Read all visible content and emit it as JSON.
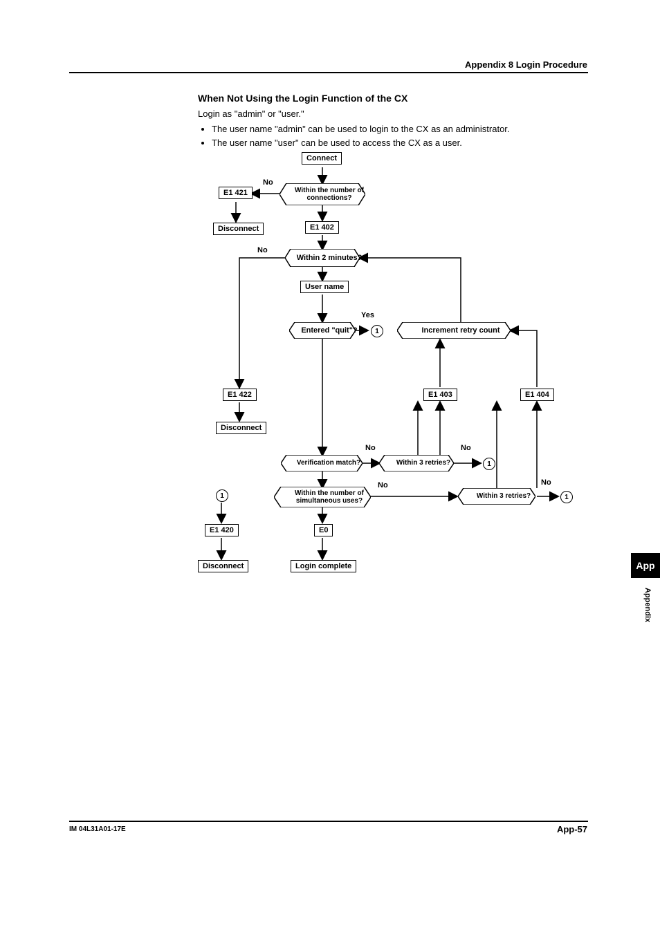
{
  "header": {
    "section": "Appendix 8  Login Procedure"
  },
  "body": {
    "title": "When Not Using the Login Function of the CX",
    "intro": "Login as \"admin\" or \"user.\"",
    "bullets": [
      "The user name \"admin\" can be used to login to the CX as an administrator.",
      "The user name \"user\" can be used to access the CX as a user."
    ]
  },
  "flow": {
    "connect": "Connect",
    "within_conn": "Within the number of connections?",
    "e1_421": "E1 421",
    "disconnect": "Disconnect",
    "e1_402": "E1 402",
    "within_2min": "Within 2 minutes?",
    "user_name": "User name",
    "entered_quit": "Entered \"quit\"?",
    "increment": "Increment retry count",
    "e1_422": "E1 422",
    "e1_403": "E1 403",
    "e1_404": "E1 404",
    "verify": "Verification match?",
    "within_3a": "Within 3 retries?",
    "within_simul": "Within the number of simultaneous uses?",
    "within_3b": "Within 3 retries?",
    "e1_420": "E1 420",
    "e0": "E0",
    "login_complete": "Login complete",
    "no": "No",
    "yes": "Yes",
    "one": "1"
  },
  "footer": {
    "doc_id": "IM 04L31A01-17E",
    "page": "App-57"
  },
  "sidetab": {
    "short": "App",
    "label": "Appendix"
  }
}
